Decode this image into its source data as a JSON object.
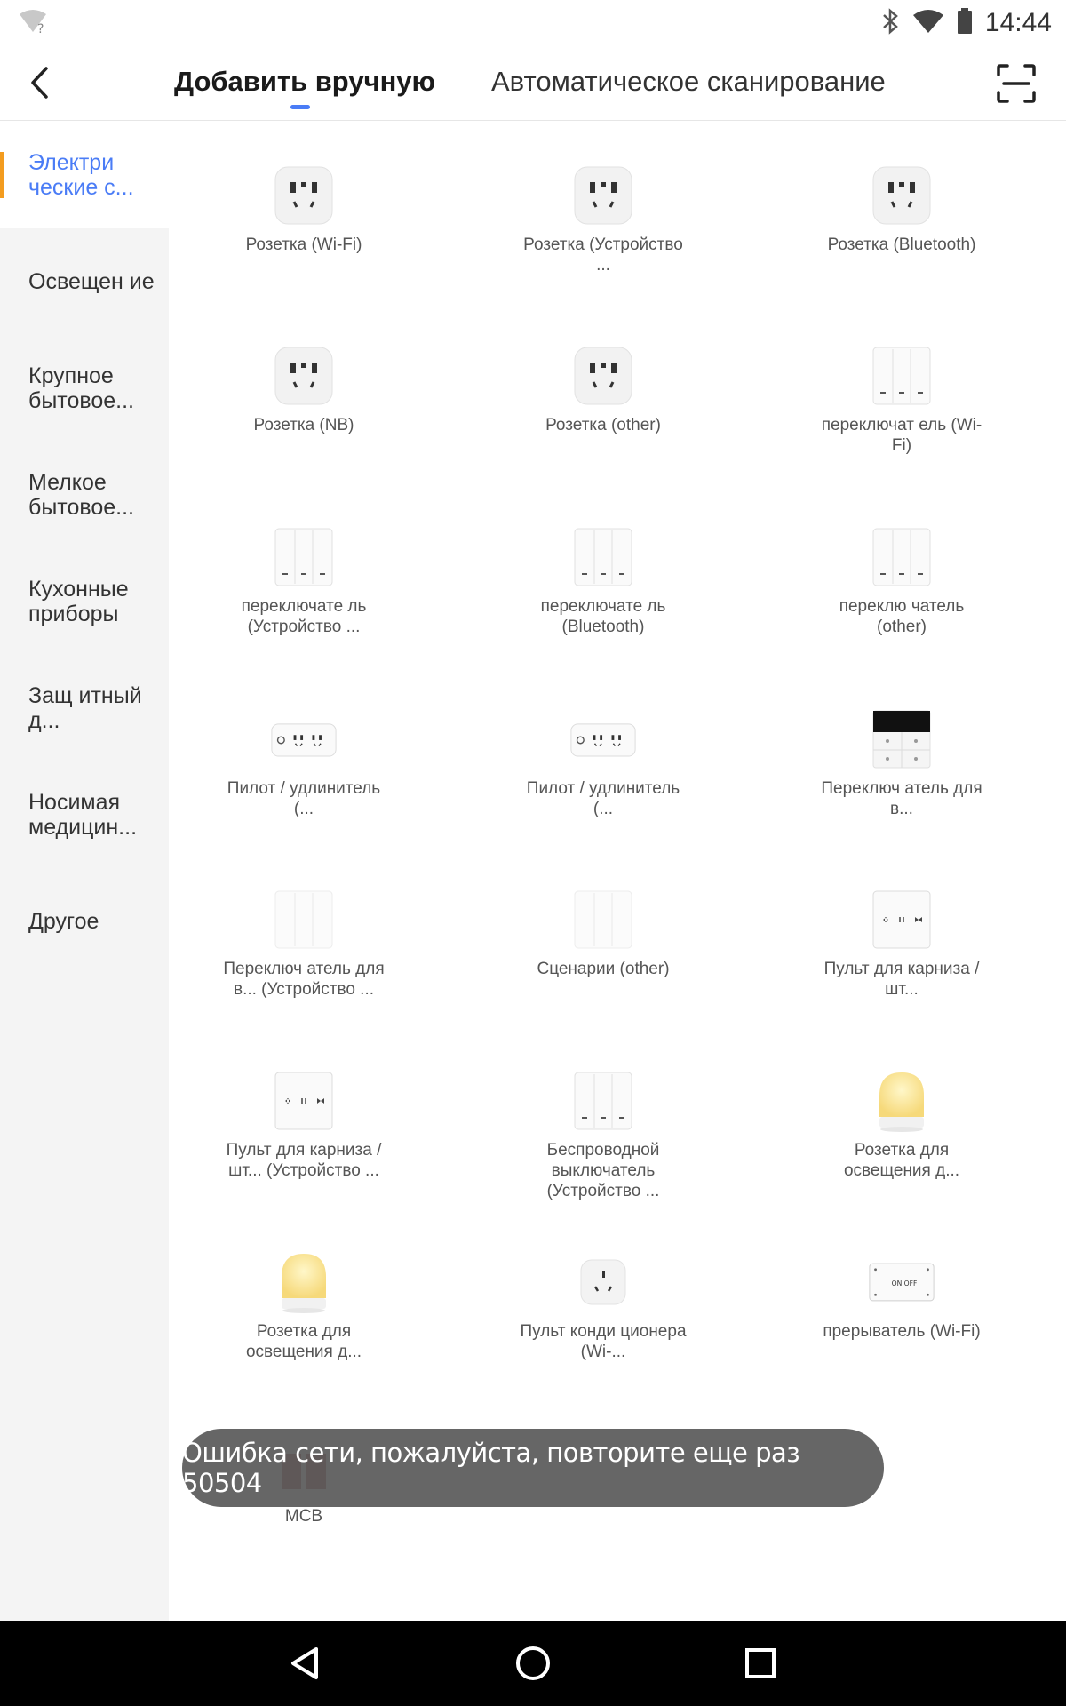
{
  "status_bar": {
    "time": "14:44",
    "wifi_icon": "wifi-question-icon",
    "bluetooth_icon": "bluetooth-icon",
    "signal_icon": "wifi-signal-icon",
    "battery_icon": "battery-icon"
  },
  "header": {
    "back_icon": "back-arrow-icon",
    "tabs": [
      {
        "label": "Добавить вручную",
        "active": true
      },
      {
        "label": "Автоматическое сканирование",
        "active": false
      }
    ],
    "scan_icon": "scan-icon",
    "accent_color": "#4a7cf6"
  },
  "sidebar": {
    "items": [
      {
        "label": "Электри ческие с...",
        "active": true
      },
      {
        "label": "Освещен ие"
      },
      {
        "label": "Крупное бытовое..."
      },
      {
        "label": "Мелкое бытовое..."
      },
      {
        "label": "Кухонные приборы"
      },
      {
        "label": "Защ итный д..."
      },
      {
        "label": "Носимая медицин..."
      },
      {
        "label": "Другое"
      }
    ],
    "active_marker_color": "#f39c1f"
  },
  "devices": [
    {
      "label": "Розетка (Wi-Fi)",
      "icon": "socket-icon"
    },
    {
      "label": "Розетка (Устройство ...",
      "icon": "socket-icon"
    },
    {
      "label": "Розетка (Bluetooth)",
      "icon": "socket-icon"
    },
    {
      "label": "Розетка (NB)",
      "icon": "socket-icon"
    },
    {
      "label": "Розетка (other)",
      "icon": "socket-icon"
    },
    {
      "label": "переключат ель (Wi-Fi)",
      "icon": "switch-icon"
    },
    {
      "label": "переключате ль (Устройство ...",
      "icon": "switch-icon"
    },
    {
      "label": "переключате ль (Bluetooth)",
      "icon": "switch-icon"
    },
    {
      "label": "переклю чатель (other)",
      "icon": "switch-icon"
    },
    {
      "label": "Пилот / удлинитель (...",
      "icon": "power-strip-icon"
    },
    {
      "label": "Пилот / удлинитель (...",
      "icon": "power-strip-icon"
    },
    {
      "label": "Переключ атель для в...",
      "icon": "scene-panel-icon"
    },
    {
      "label": "Переключ атель для в... (Устройство ...",
      "icon": "blank-switch-icon"
    },
    {
      "label": "Сценарии (other)",
      "icon": "blank-switch-icon"
    },
    {
      "label": "Пульт для карниза / шт...",
      "icon": "curtain-switch-icon"
    },
    {
      "label": "Пульт для карниза / шт... (Устройство ...",
      "icon": "curtain-switch-icon"
    },
    {
      "label": "Беспроводной выключатель (Устройство ...",
      "icon": "switch-icon"
    },
    {
      "label": "Розетка для освещения д...",
      "icon": "lamp-icon"
    },
    {
      "label": "Розетка для освещения д...",
      "icon": "lamp-icon"
    },
    {
      "label": "Пульт конди ционера (Wi-...",
      "icon": "ac-remote-icon"
    },
    {
      "label": "прерыватель (Wi-Fi)",
      "icon": "breaker-icon"
    },
    {
      "label": "MCB",
      "icon": "mcb-icon"
    }
  ],
  "toast": {
    "text": "Ошибка сети, пожалуйста, повторите еще раз 50504"
  },
  "nav_bar": {
    "back_icon": "nav-back-icon",
    "home_icon": "nav-home-icon",
    "recents_icon": "nav-recents-icon"
  }
}
